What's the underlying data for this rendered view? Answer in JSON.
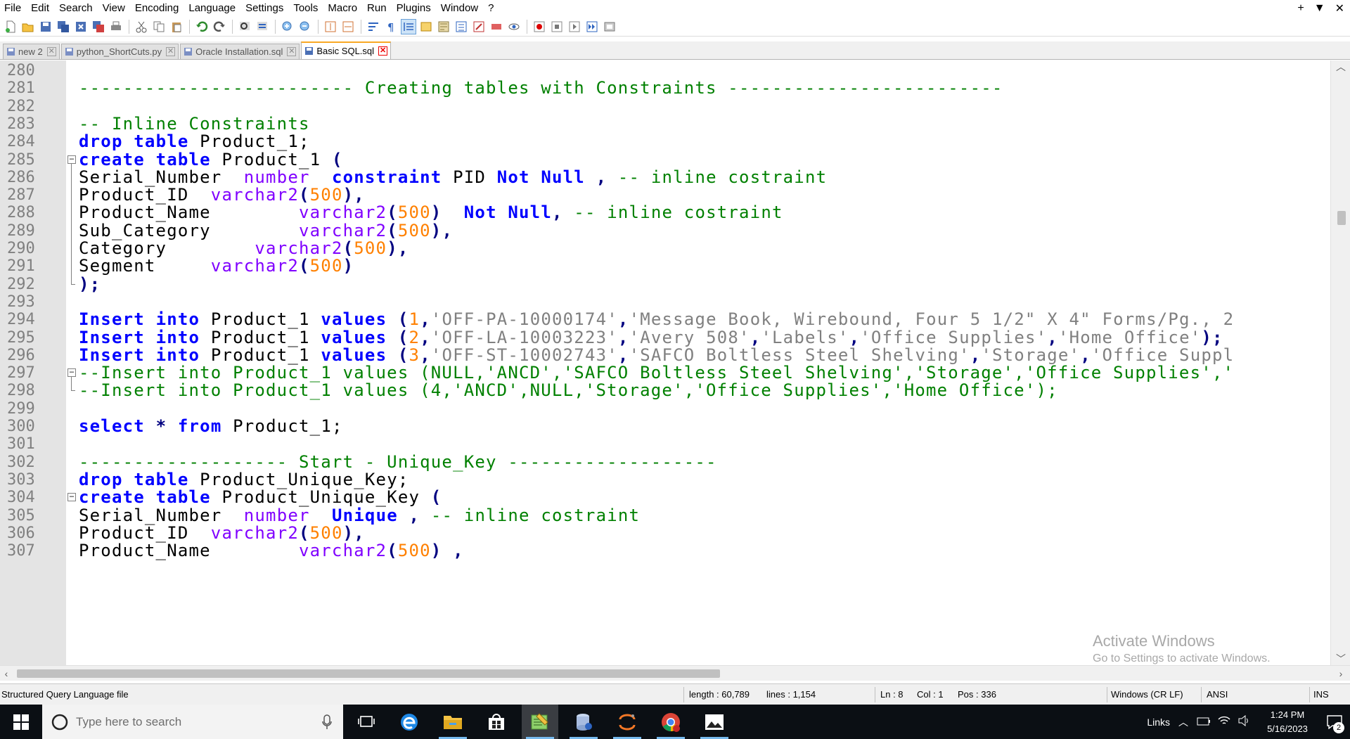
{
  "menu": [
    "File",
    "Edit",
    "Search",
    "View",
    "Encoding",
    "Language",
    "Settings",
    "Tools",
    "Macro",
    "Run",
    "Plugins",
    "Window",
    "?"
  ],
  "window_controls": {
    "add": "+",
    "dropdown": "▼",
    "close": "✕"
  },
  "toolbar_icons": [
    "new-file-icon",
    "open-file-icon",
    "save-icon",
    "save-all-icon",
    "close-icon",
    "close-all-icon",
    "print-icon",
    "cut-icon",
    "copy-icon",
    "paste-icon",
    "undo-icon",
    "redo-icon",
    "find-icon",
    "replace-icon",
    "zoom-in-icon",
    "zoom-out-icon",
    "sync-vertical-icon",
    "sync-horizontal-icon",
    "word-wrap-icon",
    "show-all-chars-icon",
    "indent-guide-icon",
    "udl-icon",
    "document-map-icon",
    "function-list-icon",
    "folder-workspace-icon",
    "monitoring-icon",
    "record-macro-icon",
    "stop-macro-icon",
    "play-macro-icon",
    "run-macro-multiple-icon",
    "save-macro-icon"
  ],
  "tabs": [
    {
      "label": "new 2",
      "active": false
    },
    {
      "label": "python_ShortCuts.py",
      "active": false
    },
    {
      "label": "Oracle Installation.sql",
      "active": false
    },
    {
      "label": "Basic SQL.sql",
      "active": true
    }
  ],
  "editor": {
    "lines": [
      {
        "n": "280",
        "tokens": []
      },
      {
        "n": "281",
        "tokens": [
          {
            "t": "------------------------- Creating tables with Constraints -------------------------",
            "c": "cm"
          }
        ]
      },
      {
        "n": "282",
        "tokens": []
      },
      {
        "n": "283",
        "tokens": [
          {
            "t": "-- Inline Constraints",
            "c": "cm"
          }
        ]
      },
      {
        "n": "284",
        "tokens": [
          {
            "t": "drop",
            "c": "kw"
          },
          {
            "t": " "
          },
          {
            "t": "table",
            "c": "kw"
          },
          {
            "t": " Product_1;"
          }
        ]
      },
      {
        "n": "285",
        "fold": "open",
        "tokens": [
          {
            "t": "create",
            "c": "kw"
          },
          {
            "t": " "
          },
          {
            "t": "table",
            "c": "kw"
          },
          {
            "t": " Product_1 "
          },
          {
            "t": "(",
            "c": "op"
          }
        ]
      },
      {
        "n": "286",
        "tokens": [
          {
            "t": "Serial_Number  "
          },
          {
            "t": "number",
            "c": "ty"
          },
          {
            "t": "  "
          },
          {
            "t": "constraint",
            "c": "kw"
          },
          {
            "t": " PID "
          },
          {
            "t": "Not",
            "c": "kw"
          },
          {
            "t": " "
          },
          {
            "t": "Null",
            "c": "kw"
          },
          {
            "t": " "
          },
          {
            "t": ",",
            "c": "op"
          },
          {
            "t": " "
          },
          {
            "t": "-- inline costraint",
            "c": "cm"
          }
        ]
      },
      {
        "n": "287",
        "tokens": [
          {
            "t": "Product_ID  "
          },
          {
            "t": "varchar2",
            "c": "ty"
          },
          {
            "t": "(",
            "c": "op"
          },
          {
            "t": "500",
            "c": "nm"
          },
          {
            "t": "),",
            "c": "op"
          }
        ]
      },
      {
        "n": "288",
        "tokens": [
          {
            "t": "Product_Name        "
          },
          {
            "t": "varchar2",
            "c": "ty"
          },
          {
            "t": "(",
            "c": "op"
          },
          {
            "t": "500",
            "c": "nm"
          },
          {
            "t": ")",
            "c": "op"
          },
          {
            "t": "  "
          },
          {
            "t": "Not",
            "c": "kw"
          },
          {
            "t": " "
          },
          {
            "t": "Null",
            "c": "kw"
          },
          {
            "t": ",",
            "c": "op"
          },
          {
            "t": " "
          },
          {
            "t": "-- inline costraint",
            "c": "cm"
          }
        ]
      },
      {
        "n": "289",
        "tokens": [
          {
            "t": "Sub_Category        "
          },
          {
            "t": "varchar2",
            "c": "ty"
          },
          {
            "t": "(",
            "c": "op"
          },
          {
            "t": "500",
            "c": "nm"
          },
          {
            "t": "),",
            "c": "op"
          }
        ]
      },
      {
        "n": "290",
        "tokens": [
          {
            "t": "Category        "
          },
          {
            "t": "varchar2",
            "c": "ty"
          },
          {
            "t": "(",
            "c": "op"
          },
          {
            "t": "500",
            "c": "nm"
          },
          {
            "t": "),",
            "c": "op"
          }
        ]
      },
      {
        "n": "291",
        "tokens": [
          {
            "t": "Segment     "
          },
          {
            "t": "varchar2",
            "c": "ty"
          },
          {
            "t": "(",
            "c": "op"
          },
          {
            "t": "500",
            "c": "nm"
          },
          {
            "t": ")",
            "c": "op"
          }
        ]
      },
      {
        "n": "292",
        "fold": "end",
        "tokens": [
          {
            "t": ");",
            "c": "op"
          }
        ]
      },
      {
        "n": "293",
        "tokens": []
      },
      {
        "n": "294",
        "tokens": [
          {
            "t": "Insert",
            "c": "kw"
          },
          {
            "t": " "
          },
          {
            "t": "into",
            "c": "kw"
          },
          {
            "t": " Product_1 "
          },
          {
            "t": "values",
            "c": "kw"
          },
          {
            "t": " "
          },
          {
            "t": "(",
            "c": "op"
          },
          {
            "t": "1",
            "c": "nm"
          },
          {
            "t": ",",
            "c": "op"
          },
          {
            "t": "'OFF-PA-10000174'",
            "c": "st"
          },
          {
            "t": ",",
            "c": "op"
          },
          {
            "t": "'Message Book, Wirebound, Four 5 1/2\" X 4\" Forms/Pg., 2",
            "c": "st"
          }
        ]
      },
      {
        "n": "295",
        "tokens": [
          {
            "t": "Insert",
            "c": "kw"
          },
          {
            "t": " "
          },
          {
            "t": "into",
            "c": "kw"
          },
          {
            "t": " Product_1 "
          },
          {
            "t": "values",
            "c": "kw"
          },
          {
            "t": " "
          },
          {
            "t": "(",
            "c": "op"
          },
          {
            "t": "2",
            "c": "nm"
          },
          {
            "t": ",",
            "c": "op"
          },
          {
            "t": "'OFF-LA-10003223'",
            "c": "st"
          },
          {
            "t": ",",
            "c": "op"
          },
          {
            "t": "'Avery 508'",
            "c": "st"
          },
          {
            "t": ",",
            "c": "op"
          },
          {
            "t": "'Labels'",
            "c": "st"
          },
          {
            "t": ",",
            "c": "op"
          },
          {
            "t": "'Office Supplies'",
            "c": "st"
          },
          {
            "t": ",",
            "c": "op"
          },
          {
            "t": "'Home Office'",
            "c": "st"
          },
          {
            "t": ");",
            "c": "op"
          }
        ]
      },
      {
        "n": "296",
        "tokens": [
          {
            "t": "Insert",
            "c": "kw"
          },
          {
            "t": " "
          },
          {
            "t": "into",
            "c": "kw"
          },
          {
            "t": " Product_1 "
          },
          {
            "t": "values",
            "c": "kw"
          },
          {
            "t": " "
          },
          {
            "t": "(",
            "c": "op"
          },
          {
            "t": "3",
            "c": "nm"
          },
          {
            "t": ",",
            "c": "op"
          },
          {
            "t": "'OFF-ST-10002743'",
            "c": "st"
          },
          {
            "t": ",",
            "c": "op"
          },
          {
            "t": "'SAFCO Boltless Steel Shelving'",
            "c": "st"
          },
          {
            "t": ",",
            "c": "op"
          },
          {
            "t": "'Storage'",
            "c": "st"
          },
          {
            "t": ",",
            "c": "op"
          },
          {
            "t": "'Office Suppl",
            "c": "st"
          }
        ]
      },
      {
        "n": "297",
        "fold": "open",
        "tokens": [
          {
            "t": "--Insert into Product_1 values (NULL,'ANCD','SAFCO Boltless Steel Shelving','Storage','Office Supplies','",
            "c": "cm"
          }
        ]
      },
      {
        "n": "298",
        "fold": "end",
        "tokens": [
          {
            "t": "--Insert into Product_1 values (4,'ANCD',NULL,'Storage','Office Supplies','Home Office');",
            "c": "cm"
          }
        ]
      },
      {
        "n": "299",
        "tokens": []
      },
      {
        "n": "300",
        "tokens": [
          {
            "t": "select",
            "c": "kw"
          },
          {
            "t": " "
          },
          {
            "t": "*",
            "c": "op"
          },
          {
            "t": " "
          },
          {
            "t": "from",
            "c": "kw"
          },
          {
            "t": " Product_1;"
          }
        ]
      },
      {
        "n": "301",
        "tokens": []
      },
      {
        "n": "302",
        "tokens": [
          {
            "t": "------------------- Start - Unique_Key -------------------",
            "c": "cm"
          }
        ]
      },
      {
        "n": "303",
        "tokens": [
          {
            "t": "drop",
            "c": "kw"
          },
          {
            "t": " "
          },
          {
            "t": "table",
            "c": "kw"
          },
          {
            "t": " Product_Unique_Key;"
          }
        ]
      },
      {
        "n": "304",
        "fold": "open",
        "tokens": [
          {
            "t": "create",
            "c": "kw"
          },
          {
            "t": " "
          },
          {
            "t": "table",
            "c": "kw"
          },
          {
            "t": " Product_Unique_Key "
          },
          {
            "t": "(",
            "c": "op"
          }
        ]
      },
      {
        "n": "305",
        "tokens": [
          {
            "t": "Serial_Number  "
          },
          {
            "t": "number",
            "c": "ty"
          },
          {
            "t": "  "
          },
          {
            "t": "Unique",
            "c": "kw"
          },
          {
            "t": " "
          },
          {
            "t": ",",
            "c": "op"
          },
          {
            "t": " "
          },
          {
            "t": "-- inline costraint",
            "c": "cm"
          }
        ]
      },
      {
        "n": "306",
        "tokens": [
          {
            "t": "Product_ID  "
          },
          {
            "t": "varchar2",
            "c": "ty"
          },
          {
            "t": "(",
            "c": "op"
          },
          {
            "t": "500",
            "c": "nm"
          },
          {
            "t": "),",
            "c": "op"
          }
        ]
      },
      {
        "n": "307",
        "tokens": [
          {
            "t": "Product_Name        "
          },
          {
            "t": "varchar2",
            "c": "ty"
          },
          {
            "t": "(",
            "c": "op"
          },
          {
            "t": "500",
            "c": "nm"
          },
          {
            "t": ")",
            "c": "op"
          },
          {
            "t": " "
          },
          {
            "t": ",",
            "c": "op"
          }
        ]
      }
    ]
  },
  "watermark": {
    "title": "Activate Windows",
    "subtitle": "Go to Settings to activate Windows."
  },
  "status": {
    "file_type": "Structured Query Language file",
    "length": "length : 60,789",
    "lines": "lines : 1,154",
    "ln": "Ln : 8",
    "col": "Col : 1",
    "pos": "Pos : 336",
    "eol": "Windows (CR LF)",
    "encoding": "ANSI",
    "mode": "INS"
  },
  "taskbar": {
    "search_placeholder": "Type here to search",
    "apps": [
      "task-view-icon",
      "edge-icon",
      "file-explorer-icon",
      "store-icon",
      "notepad-plus-plus-icon",
      "sql-developer-icon",
      "jupyter-icon",
      "chrome-icon",
      "photos-icon"
    ],
    "tray_links": "Links",
    "time": "1:24 PM",
    "date": "5/16/2023",
    "notification_count": "2"
  }
}
